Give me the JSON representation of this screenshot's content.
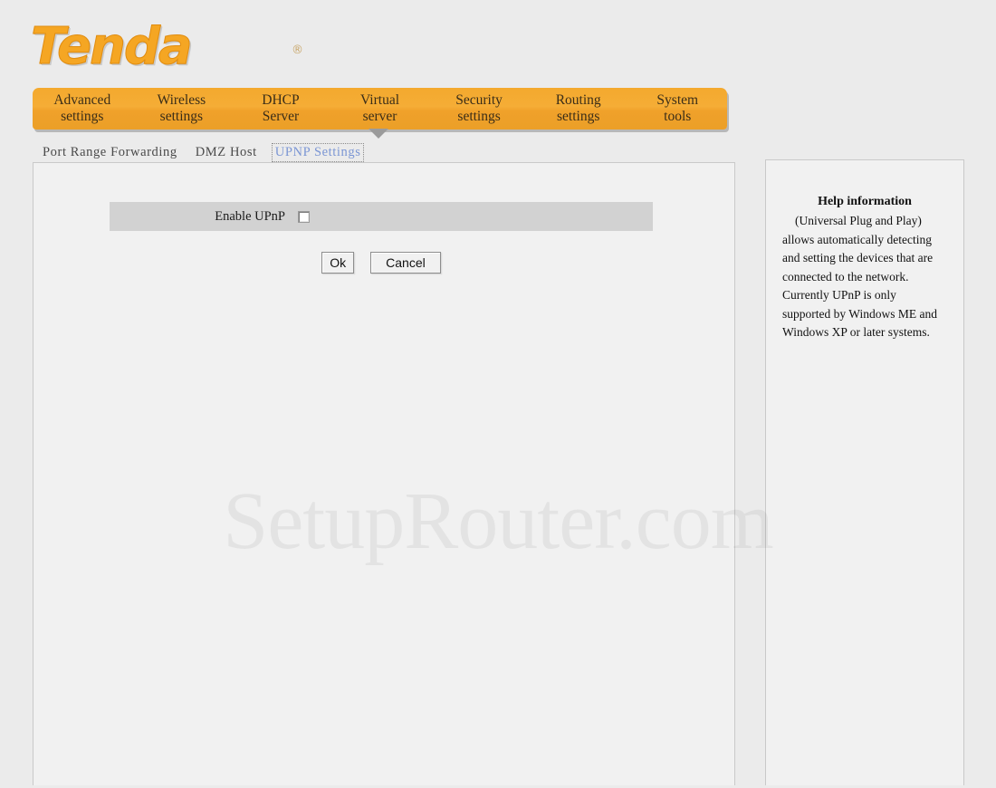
{
  "brand": {
    "logo_text": "Tenda",
    "registered_mark": "®"
  },
  "main_nav": {
    "items": [
      {
        "line1": "Advanced",
        "line2": "settings"
      },
      {
        "line1": "Wireless",
        "line2": "settings"
      },
      {
        "line1": "DHCP",
        "line2": "Server"
      },
      {
        "line1": "Virtual",
        "line2": "server"
      },
      {
        "line1": "Security",
        "line2": "settings"
      },
      {
        "line1": "Routing",
        "line2": "settings"
      },
      {
        "line1": "System",
        "line2": "tools"
      }
    ],
    "active_index": 3,
    "bar_color": "#f2a62e"
  },
  "sub_nav": {
    "items": [
      {
        "label": "Port Range Forwarding",
        "active": false
      },
      {
        "label": "DMZ Host",
        "active": false
      },
      {
        "label": "UPNP Settings",
        "active": true
      }
    ],
    "active_color": "#7b96d4"
  },
  "form": {
    "enable_upnp_label": "Enable UPnP",
    "enable_upnp_checked": false,
    "row_background": "#d2d2d2",
    "ok_label": "Ok",
    "cancel_label": "Cancel"
  },
  "help": {
    "title": "Help information",
    "body": "(Universal Plug and Play) allows automatically detecting and setting the devices that are connected to the network. Currently UPnP is only supported by Windows ME and Windows XP or later systems."
  },
  "watermark": {
    "text": "SetupRouter.com"
  }
}
